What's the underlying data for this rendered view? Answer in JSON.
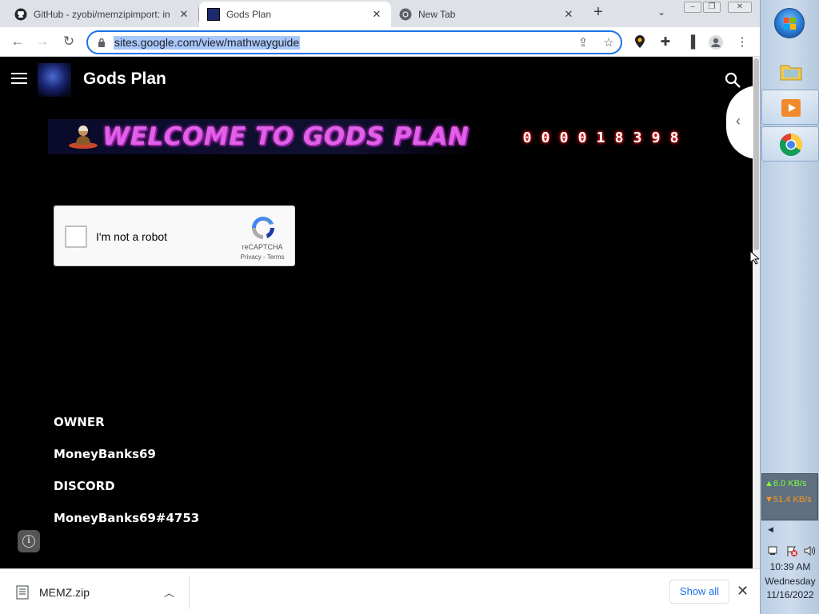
{
  "browser": {
    "tabs": [
      {
        "title": "GitHub - zyobi/memzipimport: in",
        "close": "✕"
      },
      {
        "title": "Gods Plan",
        "close": "✕"
      },
      {
        "title": "New Tab",
        "close": "✕"
      }
    ],
    "new_tab": "+",
    "tab_search": "⌄",
    "url": "sites.google.com/view/mathwayguide",
    "active_tab_index": 1
  },
  "page": {
    "site_title": "Gods Plan",
    "banner_text": "WELCOME TO GODS PLAN",
    "hit_counter": [
      "0",
      "0",
      "0",
      "0",
      "1",
      "8",
      "3",
      "9",
      "8"
    ],
    "recaptcha": {
      "label": "I'm not a robot",
      "brand": "reCAPTCHA",
      "links": "Privacy - Terms"
    },
    "info": [
      {
        "text": "OWNER"
      },
      {
        "text": "MoneyBanks69"
      },
      {
        "text": "DISCORD"
      },
      {
        "text": "MoneyBanks69#4753"
      }
    ],
    "info_button": "i"
  },
  "downloads": {
    "file_name": "MEMZ.zip",
    "show_all": "Show all",
    "close": "✕"
  },
  "taskbar": {
    "net_up": "▲6.0 KB/s",
    "net_down": "▼51.4 KB/s",
    "time": "10:39 AM",
    "day": "Wednesday",
    "date": "11/16/2022"
  },
  "colors": {
    "chrome_accent": "#1a73e8",
    "banner_text": "#e060e8",
    "counter_glow": "#ff2020",
    "page_background": "#000000"
  }
}
